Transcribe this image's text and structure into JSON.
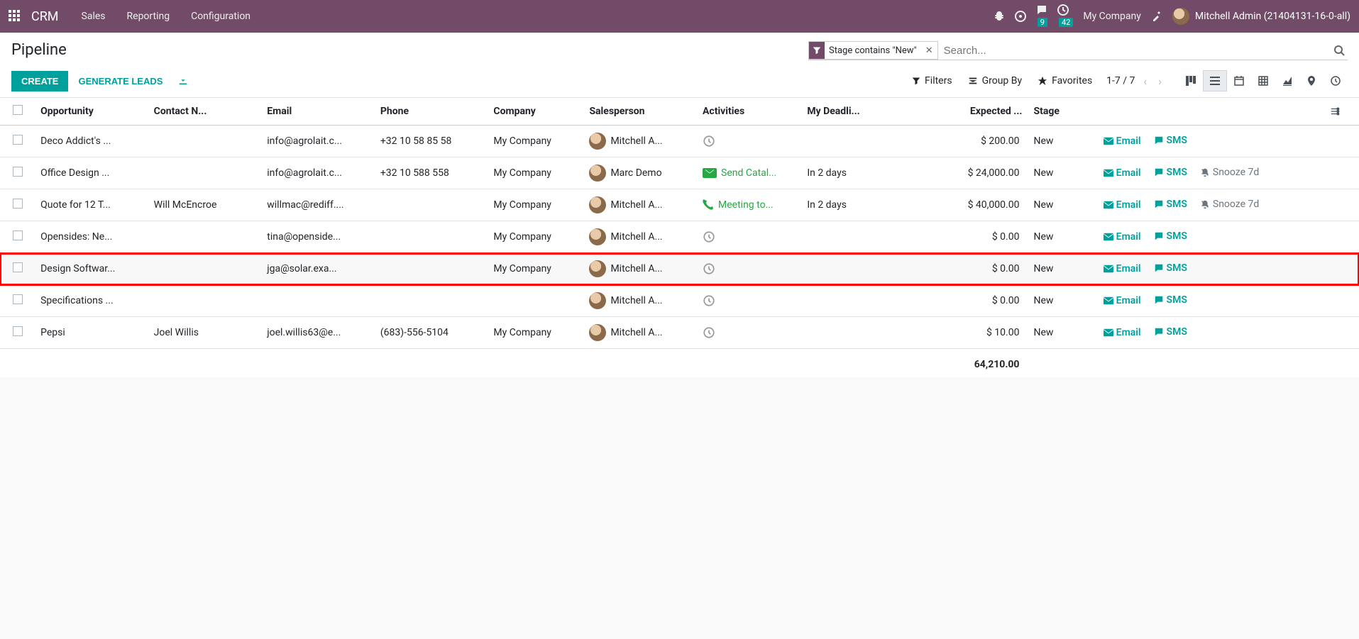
{
  "navbar": {
    "brand": "CRM",
    "menus": [
      "Sales",
      "Reporting",
      "Configuration"
    ],
    "messages_badge": "9",
    "activities_badge": "42",
    "company": "My Company",
    "user": "Mitchell Admin (21404131-16-0-all)"
  },
  "breadcrumb": "Pipeline",
  "search": {
    "facet_label": "Stage contains \"New\"",
    "placeholder": "Search..."
  },
  "buttons": {
    "create": "CREATE",
    "generate": "GENERATE LEADS"
  },
  "search_options": {
    "filters": "Filters",
    "groupby": "Group By",
    "favorites": "Favorites"
  },
  "pager": "1-7 / 7",
  "columns": {
    "opportunity": "Opportunity",
    "contact": "Contact N...",
    "email": "Email",
    "phone": "Phone",
    "company": "Company",
    "salesperson": "Salesperson",
    "activities": "Activities",
    "deadline": "My Deadli...",
    "expected": "Expected ...",
    "stage": "Stage"
  },
  "action_labels": {
    "email": "Email",
    "sms": "SMS",
    "snooze": "Snooze 7d"
  },
  "rows": [
    {
      "opportunity": "Deco Addict's ...",
      "contact": "",
      "email": "info@agrolait.c...",
      "phone": "+32 10 58 85 58",
      "company": "My Company",
      "salesperson": "Mitchell A...",
      "activity_type": "clock",
      "activity_text": "",
      "deadline": "",
      "expected": "$ 200.00",
      "stage": "New",
      "snooze": false,
      "highlight": false
    },
    {
      "opportunity": "Office Design ...",
      "contact": "",
      "email": "info@agrolait.c...",
      "phone": "+32 10 588 558",
      "company": "My Company",
      "salesperson": "Marc Demo",
      "activity_type": "envelope",
      "activity_text": "Send Catal...",
      "deadline": "In 2 days",
      "expected": "$ 24,000.00",
      "stage": "New",
      "snooze": true,
      "highlight": false
    },
    {
      "opportunity": "Quote for 12 T...",
      "contact": "Will McEncroe",
      "email": "willmac@rediff....",
      "phone": "",
      "company": "My Company",
      "salesperson": "Mitchell A...",
      "activity_type": "phone",
      "activity_text": "Meeting to...",
      "deadline": "In 2 days",
      "expected": "$ 40,000.00",
      "stage": "New",
      "snooze": true,
      "highlight": false
    },
    {
      "opportunity": "Opensides: Ne...",
      "contact": "",
      "email": "tina@openside...",
      "phone": "",
      "company": "My Company",
      "salesperson": "Mitchell A...",
      "activity_type": "clock",
      "activity_text": "",
      "deadline": "",
      "expected": "$ 0.00",
      "stage": "New",
      "snooze": false,
      "highlight": false
    },
    {
      "opportunity": "Design Softwar...",
      "contact": "",
      "email": "jga@solar.exa...",
      "phone": "",
      "company": "My Company",
      "salesperson": "Mitchell A...",
      "activity_type": "clock",
      "activity_text": "",
      "deadline": "",
      "expected": "$ 0.00",
      "stage": "New",
      "snooze": false,
      "highlight": true
    },
    {
      "opportunity": "Specifications ...",
      "contact": "",
      "email": "",
      "phone": "",
      "company": "",
      "salesperson": "Mitchell A...",
      "activity_type": "clock",
      "activity_text": "",
      "deadline": "",
      "expected": "$ 0.00",
      "stage": "New",
      "snooze": false,
      "highlight": false
    },
    {
      "opportunity": "Pepsi",
      "contact": "Joel Willis",
      "email": "joel.willis63@e...",
      "phone": "(683)-556-5104",
      "company": "My Company",
      "salesperson": "Mitchell A...",
      "activity_type": "clock",
      "activity_text": "",
      "deadline": "",
      "expected": "$ 10.00",
      "stage": "New",
      "snooze": false,
      "highlight": false
    }
  ],
  "total_expected": "64,210.00"
}
